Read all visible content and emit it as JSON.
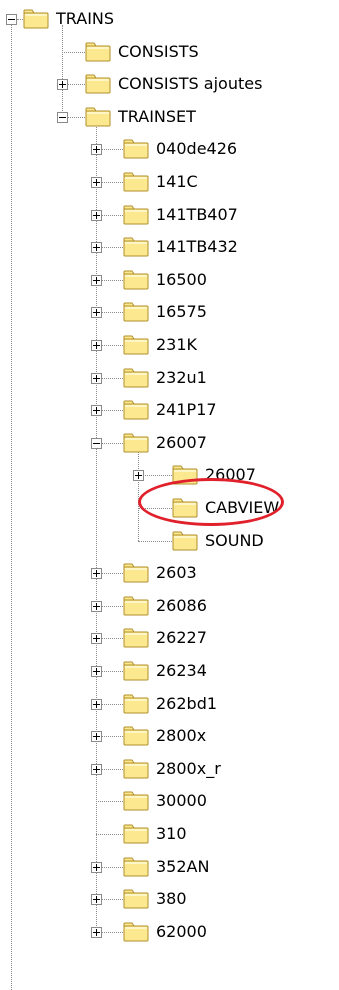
{
  "tree": {
    "nodes": [
      {
        "label": "TRAINS",
        "level": 0,
        "expander": "minus"
      },
      {
        "label": "CONSISTS",
        "level": 1,
        "expander": "none"
      },
      {
        "label": "CONSISTS ajoutes",
        "level": 1,
        "expander": "plus"
      },
      {
        "label": "TRAINSET",
        "level": 1,
        "expander": "minus"
      },
      {
        "label": "040de426",
        "level": 2,
        "expander": "plus"
      },
      {
        "label": "141C",
        "level": 2,
        "expander": "plus"
      },
      {
        "label": "141TB407",
        "level": 2,
        "expander": "plus"
      },
      {
        "label": "141TB432",
        "level": 2,
        "expander": "plus"
      },
      {
        "label": "16500",
        "level": 2,
        "expander": "plus"
      },
      {
        "label": "16575",
        "level": 2,
        "expander": "plus"
      },
      {
        "label": "231K",
        "level": 2,
        "expander": "plus"
      },
      {
        "label": "232u1",
        "level": 2,
        "expander": "plus"
      },
      {
        "label": "241P17",
        "level": 2,
        "expander": "plus"
      },
      {
        "label": "26007",
        "level": 2,
        "expander": "minus"
      },
      {
        "label": "26007",
        "level": 3,
        "expander": "plus",
        "highlighted": true
      },
      {
        "label": "CABVIEW",
        "level": 3,
        "expander": "none"
      },
      {
        "label": "SOUND",
        "level": 3,
        "expander": "none"
      },
      {
        "label": "2603",
        "level": 2,
        "expander": "plus"
      },
      {
        "label": "26086",
        "level": 2,
        "expander": "plus"
      },
      {
        "label": "26227",
        "level": 2,
        "expander": "plus"
      },
      {
        "label": "26234",
        "level": 2,
        "expander": "plus"
      },
      {
        "label": "262bd1",
        "level": 2,
        "expander": "plus"
      },
      {
        "label": "2800x",
        "level": 2,
        "expander": "plus"
      },
      {
        "label": "2800x_r",
        "level": 2,
        "expander": "plus"
      },
      {
        "label": "30000",
        "level": 2,
        "expander": "none"
      },
      {
        "label": "310",
        "level": 2,
        "expander": "none"
      },
      {
        "label": "352AN",
        "level": 2,
        "expander": "plus"
      },
      {
        "label": "380",
        "level": 2,
        "expander": "plus"
      },
      {
        "label": "62000",
        "level": 2,
        "expander": "plus"
      }
    ]
  },
  "colors": {
    "folder_fill": "#fce98f",
    "folder_stroke": "#b08e2a",
    "tree_lines": "#8a8a8a",
    "highlight_ring": "#e0202a"
  },
  "icons": {
    "folder": "folder-icon",
    "expand": "plus-expander-icon",
    "collapse": "minus-expander-icon"
  }
}
